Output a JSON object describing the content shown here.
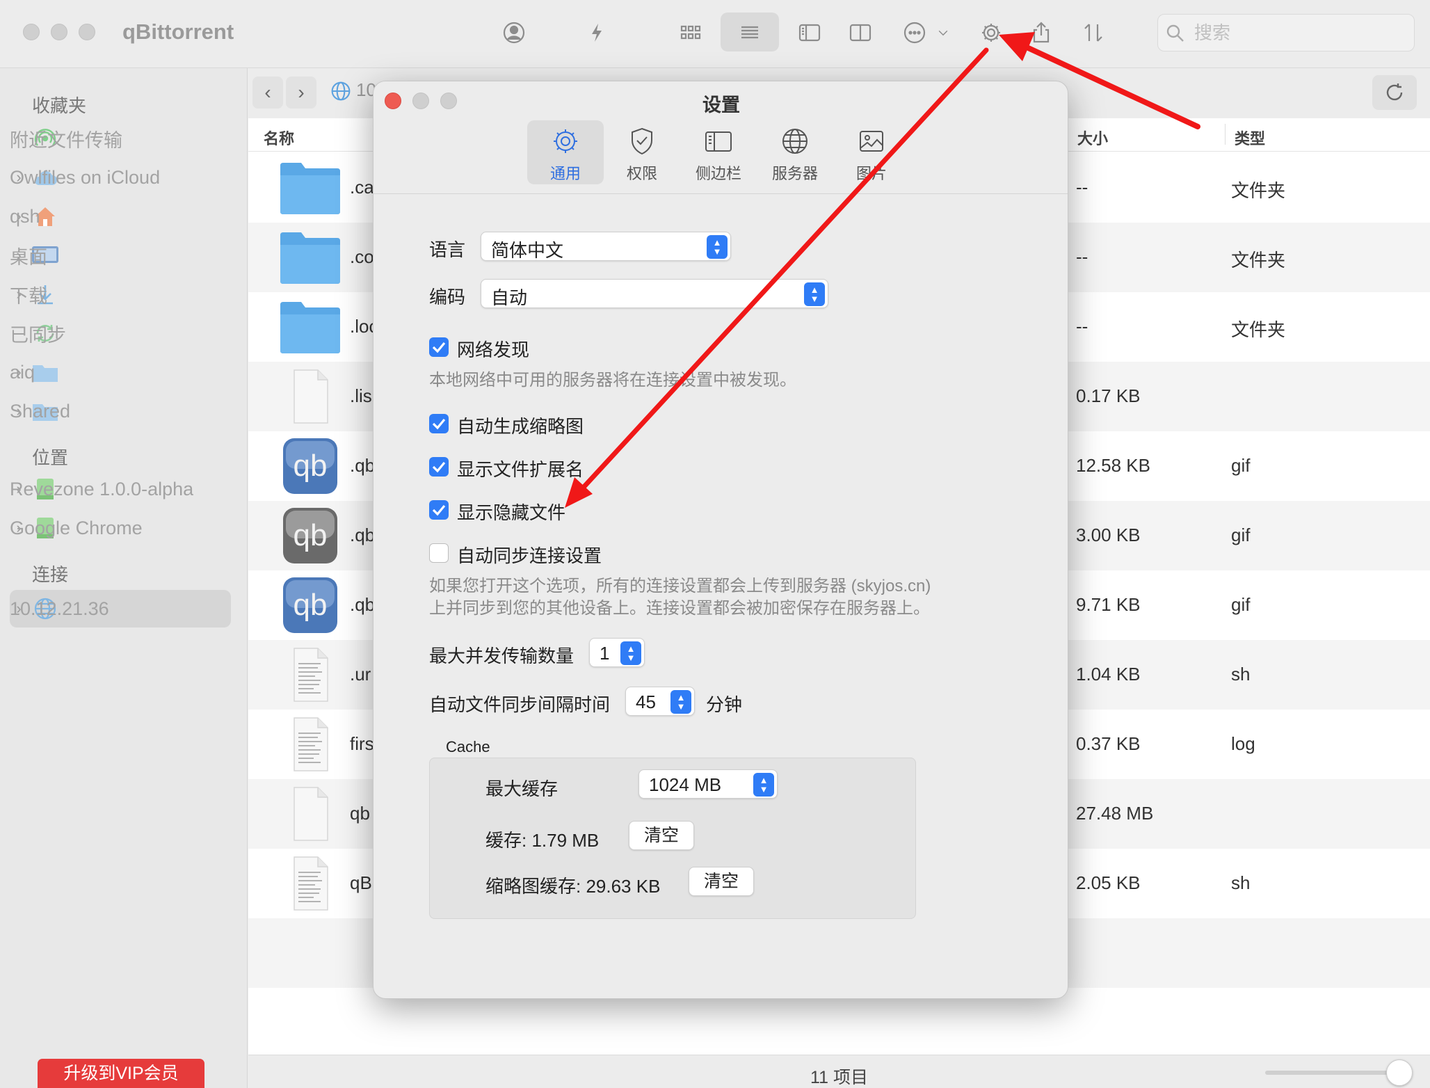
{
  "app": {
    "title": "qBittorrent",
    "search_placeholder": "搜索"
  },
  "toolbar": {
    "icons": [
      "user-circle-icon",
      "bolt-icon",
      "grid-view-icon",
      "list-view-icon",
      "sidebar-toggle-icon",
      "split-view-icon",
      "more-icon",
      "gear-icon",
      "share-icon",
      "sort-icon"
    ]
  },
  "sidebar": {
    "favorites_header": "收藏夹",
    "favorites": [
      {
        "label": "附近文件传输",
        "icon": "airdrop-icon",
        "expandable": false
      },
      {
        "label": "Owlfiles on iCloud",
        "icon": "icloud-icon",
        "expandable": true
      },
      {
        "label": "qsh",
        "icon": "home-icon",
        "expandable": true
      },
      {
        "label": "桌面",
        "icon": "desktop-icon",
        "expandable": true
      },
      {
        "label": "下载",
        "icon": "download-icon",
        "expandable": true
      },
      {
        "label": "已同步",
        "icon": "sync-icon",
        "expandable": false
      },
      {
        "label": "aiq",
        "icon": "folder-icon",
        "expandable": true
      },
      {
        "label": "Shared",
        "icon": "folder-icon",
        "expandable": true
      }
    ],
    "locations_header": "位置",
    "locations": [
      {
        "label": "Revezone 1.0.0-alpha",
        "icon": "drive-icon",
        "expandable": true
      },
      {
        "label": "Google Chrome",
        "icon": "drive-icon",
        "expandable": true
      }
    ],
    "connections_header": "连接",
    "connections": [
      {
        "label": "10.12.21.36",
        "icon": "globe-icon",
        "expandable": true
      }
    ],
    "vip_button": "升级到VIP会员"
  },
  "main": {
    "path_text": "10",
    "columns": {
      "name": "名称",
      "size": "大小",
      "type": "类型"
    },
    "rows": [
      {
        "name": ".ca",
        "size": "--",
        "type": "文件夹",
        "icon": "folder-icon"
      },
      {
        "name": ".co",
        "size": "--",
        "type": "文件夹",
        "icon": "folder-icon"
      },
      {
        "name": ".loc",
        "size": "--",
        "type": "文件夹",
        "icon": "folder-icon"
      },
      {
        "name": ".lis",
        "size": "0.17 KB",
        "type": "",
        "icon": "file-icon"
      },
      {
        "name": ".qb",
        "size": "12.58 KB",
        "type": "gif",
        "icon": "qb-blue-icon"
      },
      {
        "name": ".qb",
        "size": "3.00 KB",
        "type": "gif",
        "icon": "qb-gray-icon"
      },
      {
        "name": ".qb",
        "size": "9.71 KB",
        "type": "gif",
        "icon": "qb-blue-icon"
      },
      {
        "name": ".ur",
        "size": "1.04 KB",
        "type": "sh",
        "icon": "text-file-icon"
      },
      {
        "name": "firs",
        "size": "0.37 KB",
        "type": "log",
        "icon": "text-file-icon"
      },
      {
        "name": "qb",
        "size": "27.48 MB",
        "type": "",
        "icon": "file-icon"
      },
      {
        "name": "qB",
        "size": "2.05 KB",
        "type": "sh",
        "icon": "text-file-icon"
      }
    ],
    "status": "11 项目"
  },
  "dialog": {
    "title": "设置",
    "tabs": [
      {
        "label": "通用",
        "icon": "gear-icon",
        "active": true
      },
      {
        "label": "权限",
        "icon": "shield-icon",
        "active": false
      },
      {
        "label": "侧边栏",
        "icon": "sidebar-icon",
        "active": false
      },
      {
        "label": "服务器",
        "icon": "globe-icon",
        "active": false
      },
      {
        "label": "图片",
        "icon": "image-icon",
        "active": false
      }
    ],
    "language_label": "语言",
    "language_value": "简体中文",
    "encoding_label": "编码",
    "encoding_value": "自动",
    "network_discovery": {
      "label": "网络发现",
      "checked": true,
      "hint": "本地网络中可用的服务器将在连接设置中被发现。"
    },
    "auto_thumbnail": {
      "label": "自动生成缩略图",
      "checked": true
    },
    "show_extension": {
      "label": "显示文件扩展名",
      "checked": true
    },
    "show_hidden": {
      "label": "显示隐藏文件",
      "checked": true
    },
    "auto_sync": {
      "label": "自动同步连接设置",
      "checked": false,
      "hint_line1": "如果您打开这个选项，所有的连接设置都会上传到服务器 (skyjos.cn)",
      "hint_line2": "上并同步到您的其他设备上。连接设置都会被加密保存在服务器上。"
    },
    "max_transfers_label": "最大并发传输数量",
    "max_transfers_value": "1",
    "sync_interval_label": "自动文件同步间隔时间",
    "sync_interval_value": "45",
    "sync_interval_unit": "分钟",
    "cache": {
      "title": "Cache",
      "max_label": "最大缓存",
      "max_value": "1024 MB",
      "cache_used": "缓存: 1.79 MB",
      "thumb_cache_used": "缩略图缓存: 29.63 KB",
      "clear_label": "清空"
    }
  },
  "annotation": {
    "color": "#f01818"
  }
}
